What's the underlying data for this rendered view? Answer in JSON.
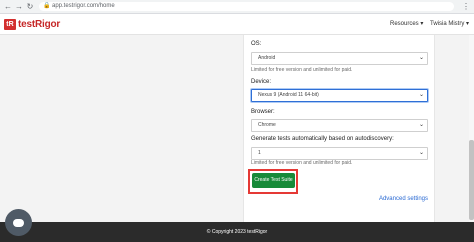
{
  "browser": {
    "url": "app.testrigor.com/home"
  },
  "navbar": {
    "brand": "testRigor",
    "resources": "Resources",
    "user": "Twisia Mistry"
  },
  "form": {
    "os": {
      "label": "OS:",
      "value": "Android",
      "note": "Limited for free version and unlimited for paid."
    },
    "device": {
      "label": "Device:",
      "value": "Nexus 9 (Android 11 64-bit)"
    },
    "browser": {
      "label": "Browser:",
      "value": "Chrome"
    },
    "autodiscovery": {
      "label": "Generate tests automatically based on autodiscovery:",
      "value": "1",
      "note": "Limited for free version and unlimited for paid."
    },
    "create_button": "Create Test Suite",
    "advanced": "Advanced settings"
  },
  "footer": {
    "copyright": "© Copyright 2023 testRigor"
  },
  "colors": {
    "brand_red": "#d32f2f",
    "button_green": "#178a39",
    "link_blue": "#2a6ad3"
  }
}
